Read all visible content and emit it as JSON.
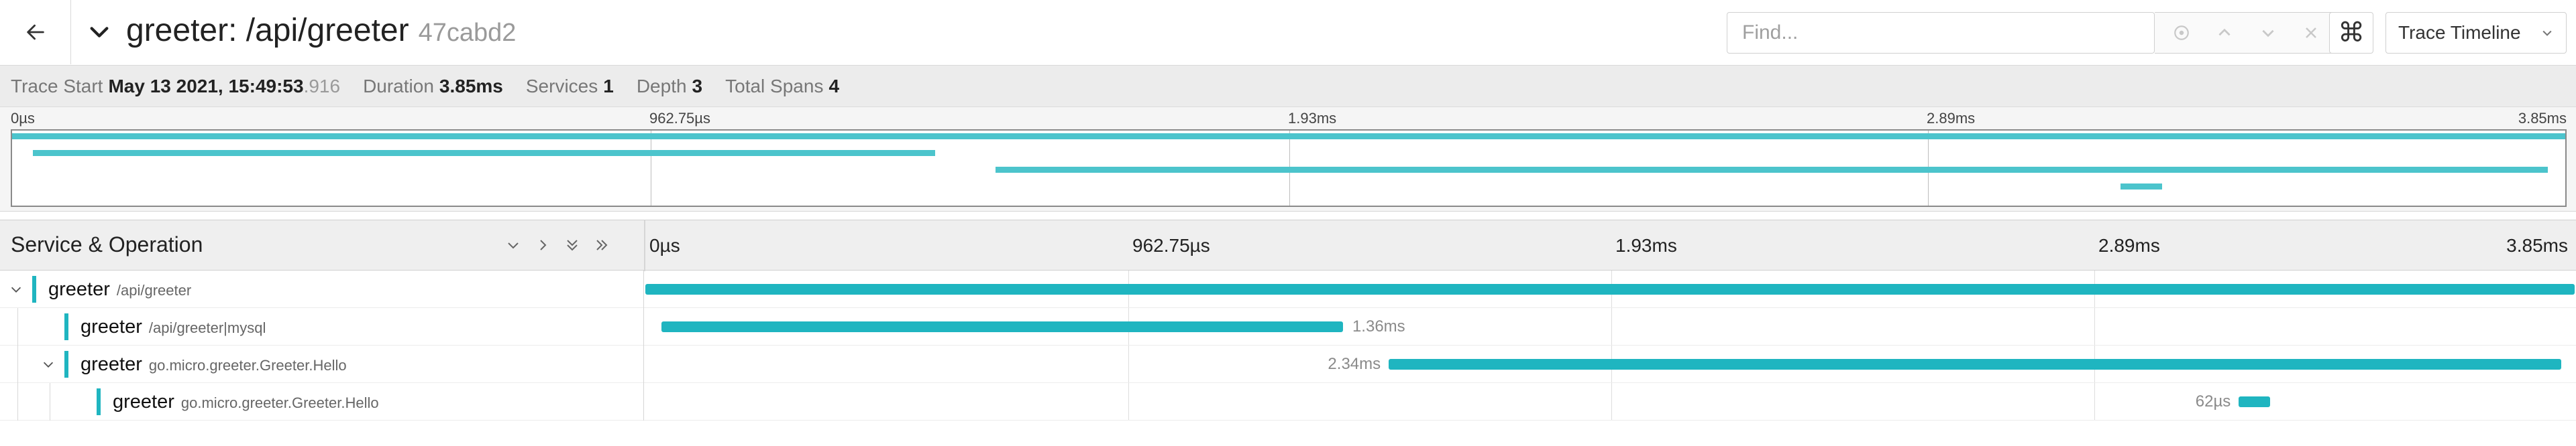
{
  "header": {
    "service": "greeter",
    "operation": "/api/greeter",
    "title_sep": ": ",
    "trace_id": "47cabd2",
    "find_placeholder": "Find...",
    "view_selector": "Trace Timeline"
  },
  "meta": {
    "trace_start_label": "Trace Start",
    "trace_start_date": "May 13 2021, 15:49:53",
    "trace_start_ms": ".916",
    "duration_label": "Duration",
    "duration_value": "3.85ms",
    "services_label": "Services",
    "services_value": "1",
    "depth_label": "Depth",
    "depth_value": "3",
    "total_spans_label": "Total Spans",
    "total_spans_value": "4"
  },
  "ticks": [
    "0µs",
    "962.75µs",
    "1.93ms",
    "2.89ms",
    "3.85ms"
  ],
  "timeline": {
    "heading": "Service & Operation",
    "total_duration_us": 3851
  },
  "spans": [
    {
      "service": "greeter",
      "operation": "/api/greeter",
      "depth": 0,
      "collapsible": true,
      "start_frac": 0.0,
      "end_frac": 1.0,
      "duration_label": ""
    },
    {
      "service": "greeter",
      "operation": "/api/greeter|mysql",
      "depth": 1,
      "collapsible": false,
      "start_frac": 0.0082,
      "end_frac": 0.3616,
      "duration_label": "1.36ms"
    },
    {
      "service": "greeter",
      "operation": "go.micro.greeter.Greeter.Hello",
      "depth": 1,
      "collapsible": true,
      "start_frac": 0.3853,
      "end_frac": 0.9931,
      "duration_label": "2.34ms"
    },
    {
      "service": "greeter",
      "operation": "go.micro.greeter.Greeter.Hello",
      "depth": 2,
      "collapsible": false,
      "start_frac": 0.8259,
      "end_frac": 0.842,
      "duration_label": "62µs"
    }
  ],
  "colors": {
    "span": "#1fb5c0",
    "minimap_span": "#4cc4cc"
  },
  "icons": {
    "back": "arrow-left-icon",
    "collapse_title": "chevron-down-icon",
    "find_tools": [
      "locate-icon",
      "chevron-up-icon",
      "chevron-down-icon",
      "close-icon"
    ],
    "command": "command-icon",
    "view_dropdown": "chevron-down-icon",
    "collapse_tools": [
      "chevron-down-icon",
      "chevron-right-icon",
      "double-chevron-down-icon",
      "double-chevron-right-icon"
    ]
  }
}
